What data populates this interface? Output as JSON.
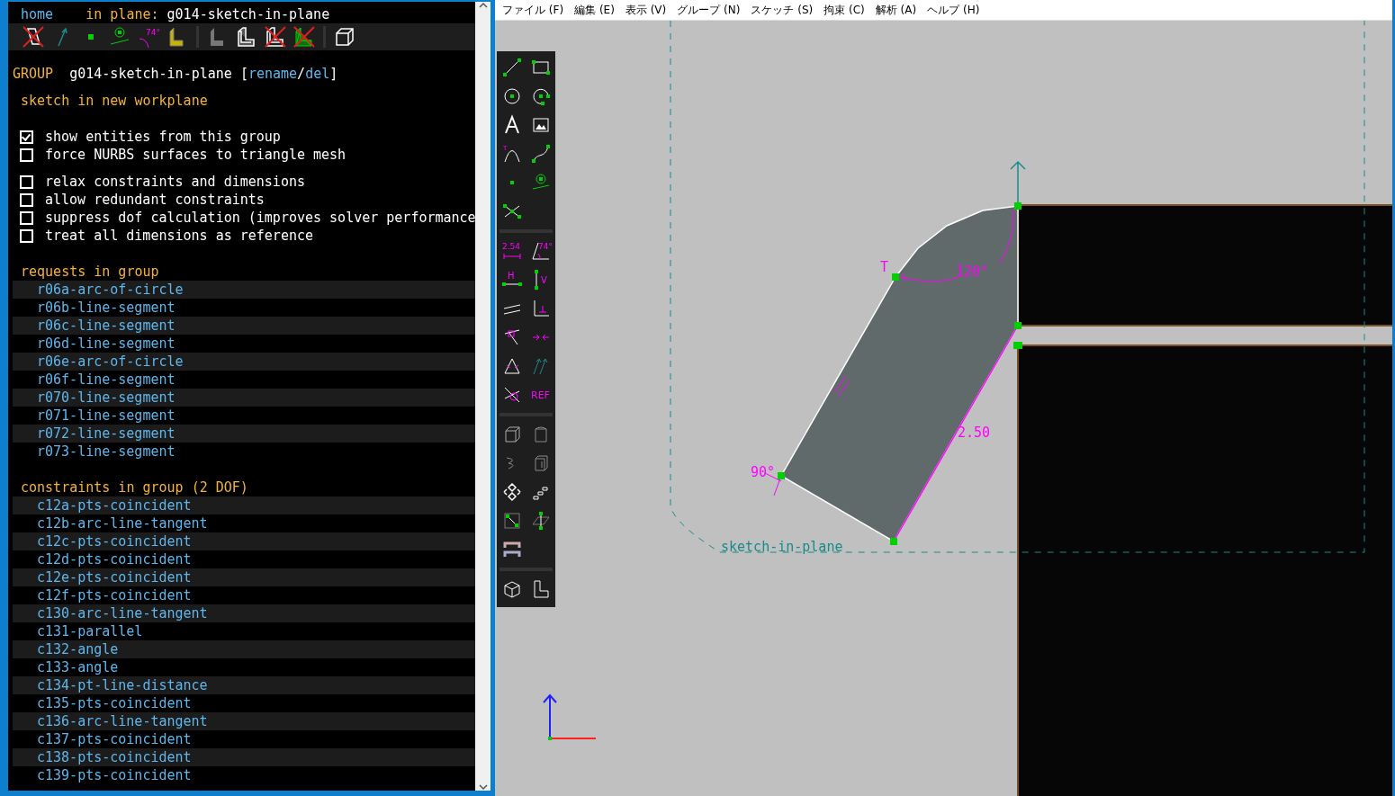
{
  "text_window": {
    "nav": {
      "home": "home",
      "in_plane_label": "in plane:",
      "plane": "g014-sketch-in-plane"
    },
    "view_toolbar": [
      {
        "kind": "workplanes",
        "on": false
      },
      {
        "kind": "normals",
        "on": true
      },
      {
        "kind": "points",
        "on": true
      },
      {
        "kind": "constraints",
        "on": true
      },
      {
        "kind": "dimensions",
        "on": true,
        "label": "74°"
      },
      {
        "kind": "shaded",
        "on": true
      },
      {
        "kind": "separator"
      },
      {
        "kind": "solid",
        "on": true
      },
      {
        "kind": "edges",
        "on": true
      },
      {
        "kind": "outlines",
        "on": false
      },
      {
        "kind": "mesh",
        "on": false
      },
      {
        "kind": "separator"
      },
      {
        "kind": "perspective",
        "on": true
      }
    ],
    "group": {
      "label": "GROUP",
      "name": "g014-sketch-in-plane",
      "open": "[",
      "rename": "rename",
      "slash": "/",
      "del": "del",
      "close": "]"
    },
    "group_type": "sketch in new workplane",
    "options": [
      [
        {
          "label": "show entities from this group",
          "checked": true
        },
        {
          "label": "force NURBS surfaces to triangle mesh",
          "checked": false
        }
      ],
      [
        {
          "label": "relax constraints and dimensions",
          "checked": false
        },
        {
          "label": "allow redundant constraints",
          "checked": false
        },
        {
          "label": "suppress dof calculation (improves solver performance",
          "checked": false
        },
        {
          "label": "treat all dimensions as reference",
          "checked": false
        }
      ]
    ],
    "requests": {
      "title": "requests in group",
      "items": [
        "r06a-arc-of-circle",
        "r06b-line-segment",
        "r06c-line-segment",
        "r06d-line-segment",
        "r06e-arc-of-circle",
        "r06f-line-segment",
        "r070-line-segment",
        "r071-line-segment",
        "r072-line-segment",
        "r073-line-segment"
      ]
    },
    "constraints": {
      "title": "constraints in group (2 DOF)",
      "items": [
        "c12a-pts-coincident",
        "c12b-arc-line-tangent",
        "c12c-pts-coincident",
        "c12d-pts-coincident",
        "c12e-pts-coincident",
        "c12f-pts-coincident",
        "c130-arc-line-tangent",
        "c131-parallel",
        "c132-angle",
        "c133-angle",
        "c134-pt-line-distance",
        "c135-pts-coincident",
        "c136-arc-line-tangent",
        "c137-pts-coincident",
        "c138-pts-coincident",
        "c139-pts-coincident"
      ]
    }
  },
  "menu": [
    "ファイル (F)",
    "編集 (E)",
    "表示 (V)",
    "グループ (N)",
    "スケッチ (S)",
    "拘束 (C)",
    "解析 (A)",
    "ヘルプ (H)"
  ],
  "tool_groups": [
    [
      {
        "kind": "line"
      },
      {
        "kind": "rectangle"
      },
      {
        "kind": "circle"
      },
      {
        "kind": "arc"
      },
      {
        "kind": "text"
      },
      {
        "kind": "image"
      },
      {
        "kind": "tangent-arc",
        "label": "T"
      },
      {
        "kind": "spline"
      },
      {
        "kind": "point"
      },
      {
        "kind": "workplane"
      },
      {
        "kind": "split"
      }
    ],
    [
      {
        "kind": "distance",
        "label": "2.54"
      },
      {
        "kind": "angle",
        "label": "74°"
      },
      {
        "kind": "horizontal",
        "label": "H"
      },
      {
        "kind": "vertical",
        "label": "V"
      },
      {
        "kind": "parallel"
      },
      {
        "kind": "perpendicular"
      },
      {
        "kind": "on-entity"
      },
      {
        "kind": "symmetric"
      },
      {
        "kind": "equal"
      },
      {
        "kind": "orientation"
      },
      {
        "kind": "other"
      },
      {
        "kind": "reference",
        "label": "REF"
      }
    ],
    [
      {
        "kind": "extrude"
      },
      {
        "kind": "lathe"
      },
      {
        "kind": "helix"
      },
      {
        "kind": "revolve"
      },
      {
        "kind": "step-rotate"
      },
      {
        "kind": "step-translate"
      },
      {
        "kind": "in-3d"
      },
      {
        "kind": "in-workplane"
      },
      {
        "kind": "link"
      }
    ],
    [
      {
        "kind": "isometric"
      },
      {
        "kind": "nearest-ortho"
      }
    ]
  ],
  "canvas": {
    "labels": [
      {
        "kind": "tangent",
        "text": "T"
      },
      {
        "kind": "angle",
        "text": "120°"
      },
      {
        "kind": "length",
        "text": "2.50"
      },
      {
        "kind": "angle",
        "text": "90°"
      },
      {
        "kind": "workplane",
        "text": "sketch-in-plane"
      }
    ]
  }
}
